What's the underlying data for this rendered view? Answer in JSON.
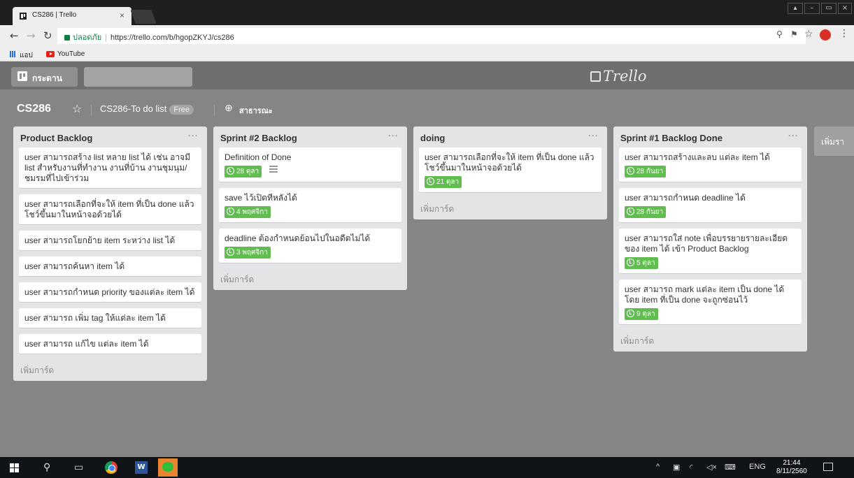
{
  "browser": {
    "tab_title": "CS286 | Trello",
    "tab_close": "×",
    "secure_label": "ปลอดภัย",
    "url": "https://trello.com/b/hgopZKYJ/cs286",
    "bookmarks": [
      "แอป",
      "YouTube"
    ],
    "window_controls": [
      "▴",
      "–",
      "▭",
      "×"
    ]
  },
  "header": {
    "boards_label": "กระดาน",
    "search_value": ""
  },
  "logo": {
    "text": "Trello"
  },
  "board": {
    "title": "CS286",
    "team": "CS286-To do list",
    "team_badge": "Free",
    "visibility": "สาธารณะ"
  },
  "lists": [
    {
      "title": "Product Backlog",
      "menu": "···",
      "cards": [
        {
          "text": "user สามารถสร้าง list หลาย list ได้ เช่น อาจมี list สำหรับงานที่ทำงาน งานที่บ้าน งานชุมนุม/ชมรมที่ไปเข้าร่วม"
        },
        {
          "text": "user สามารถเลือกที่จะให้ item ที่เป็น done แล้วโชว์ขึ้นมาในหน้าจอด้วยได้"
        },
        {
          "text": "user สามารถโยกย้าย item ระหว่าง list ได้"
        },
        {
          "text": "user สามารถค้นหา item ได้"
        },
        {
          "text": "user สามารถกำหนด priority ของแต่ละ item ได้"
        },
        {
          "text": "user สามารถ เพิ่ม tag ให้แต่ละ item ได้"
        },
        {
          "text": "user สามารถ แก้ไข แต่ละ item ได้"
        }
      ],
      "add_card": "เพิ่มการ์ด"
    },
    {
      "title": "Sprint #2 Backlog",
      "menu": "···",
      "cards": [
        {
          "text": "Definition of Done",
          "due": "28 ตุลา",
          "has_description": true
        },
        {
          "text": "save ไว้เปิดทีหลังได้",
          "due": "4 พฤศจิกา"
        },
        {
          "text": "deadline ต้องกำหนดย้อนไปในอดีตไม่ได้",
          "due": "3 พฤศจิกา"
        }
      ],
      "add_card": "เพิ่มการ์ด"
    },
    {
      "title": "doing",
      "menu": "···",
      "cards": [
        {
          "text": "user สามารถเลือกที่จะให้ item ที่เป็น done แล้วโชว์ขึ้นมาในหน้าจอด้วยได้",
          "due": "21 ตุลา"
        }
      ],
      "add_card": "เพิ่มการ์ด"
    },
    {
      "title": "Sprint #1 Backlog Done",
      "menu": "···",
      "cards": [
        {
          "text": "user สามารถสร้างและลบ แต่ละ item ได้",
          "due": "28 กันยา"
        },
        {
          "text": "user สามารถกำหนด deadline ได้",
          "due": "28 กันยา"
        },
        {
          "text": "user สามารถใส่ note เพื่อบรรยายรายละเอียดของ item ได้ เข้า Product Backlog",
          "due": "5 ตุลา"
        },
        {
          "text": "user สามารถ mark แต่ละ item เป็น done ได้ โดย item ที่เป็น done จะถูกซ่อนไว้",
          "due": "9 ตุลา"
        }
      ],
      "add_card": "เพิ่มการ์ด"
    }
  ],
  "add_list": "เพิ่มรา",
  "taskbar": {
    "language": "ENG",
    "time": "21:44",
    "date": "8/11/2560"
  },
  "colors": {
    "due_badge": "#61bd4f",
    "list_bg": "#e2e4e6",
    "board_bg": "#858585"
  }
}
